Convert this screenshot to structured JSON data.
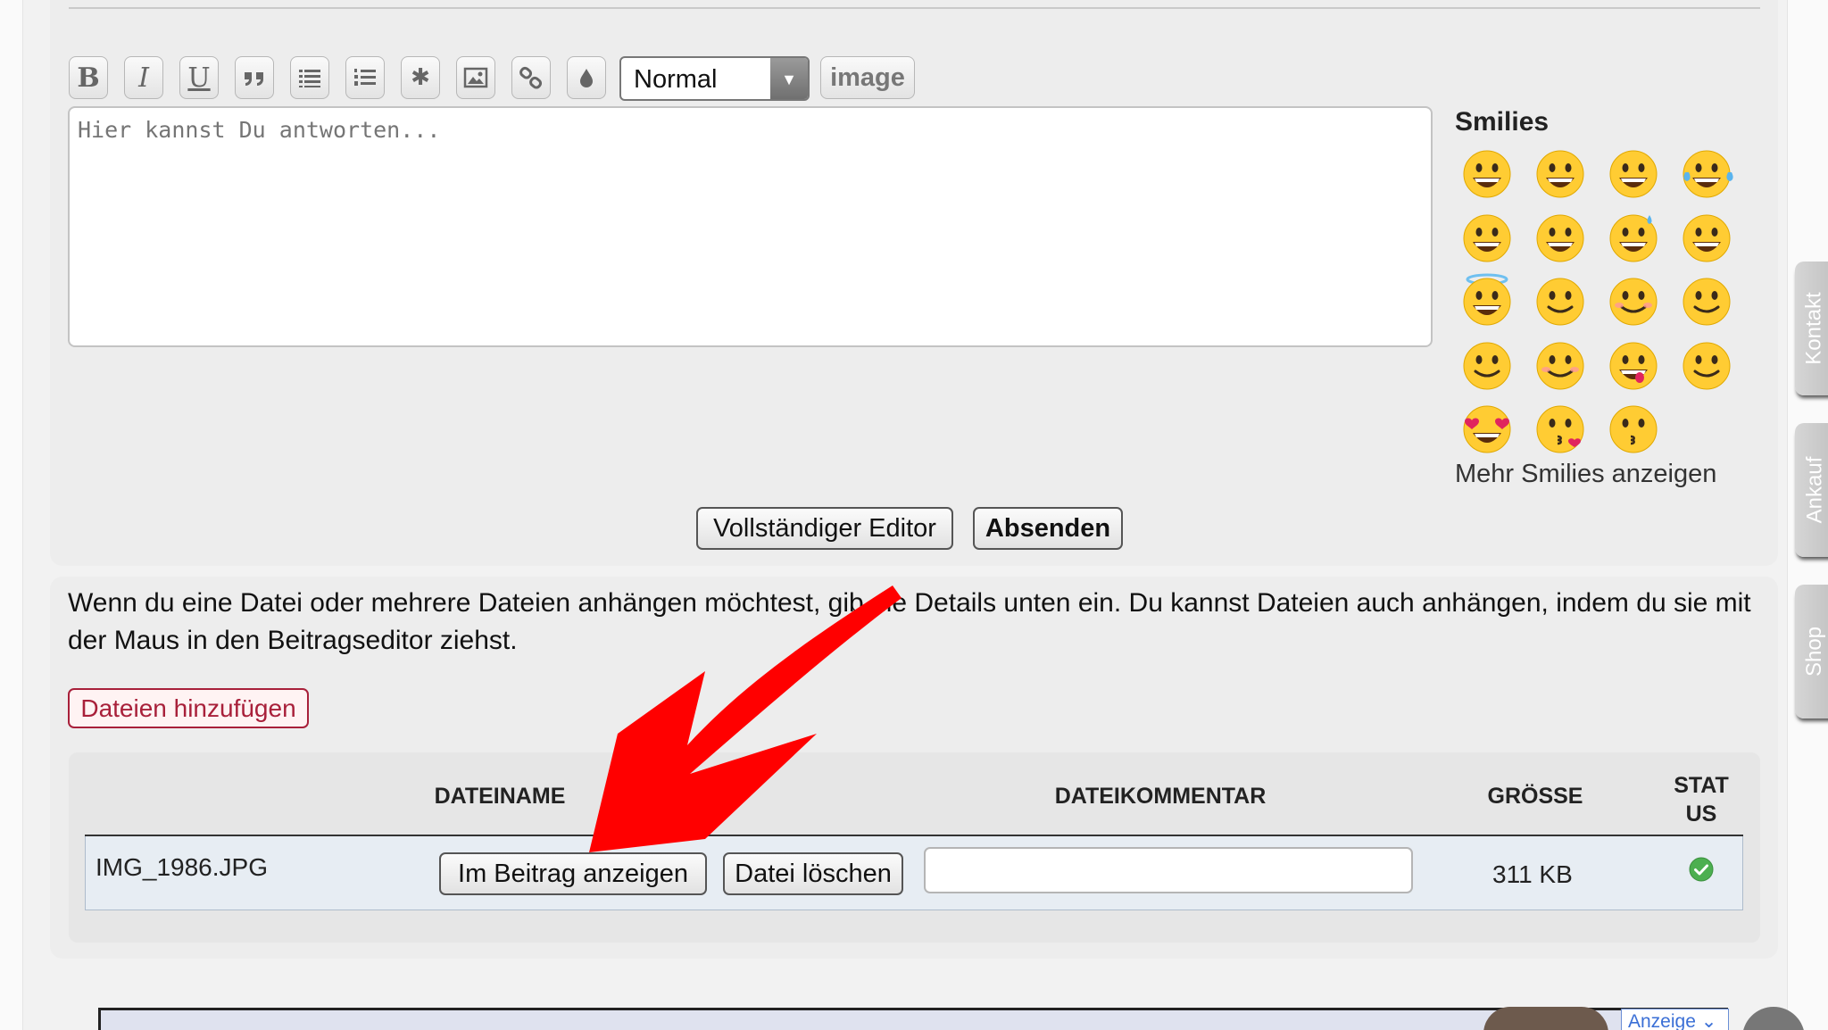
{
  "toolbar": {
    "buttons": [
      {
        "name": "bold-button",
        "icon": "bold-icon",
        "glyph": "B"
      },
      {
        "name": "italic-button",
        "icon": "italic-icon",
        "glyph": "I"
      },
      {
        "name": "underline-button",
        "icon": "underline-icon",
        "glyph": "U"
      },
      {
        "name": "quote-button",
        "icon": "quote-icon",
        "glyph": ""
      },
      {
        "name": "bullet-list-button",
        "icon": "bullet-list-icon",
        "glyph": ""
      },
      {
        "name": "numbered-list-button",
        "icon": "numbered-list-icon",
        "glyph": ""
      },
      {
        "name": "spoiler-button",
        "icon": "asterisk-icon",
        "glyph": "✱"
      },
      {
        "name": "insert-image-button",
        "icon": "picture-icon",
        "glyph": ""
      },
      {
        "name": "insert-link-button",
        "icon": "link-icon",
        "glyph": ""
      },
      {
        "name": "color-button",
        "icon": "droplet-icon",
        "glyph": ""
      }
    ],
    "format_select": {
      "value": "Normal"
    },
    "image_label": "image"
  },
  "editor": {
    "placeholder": "Hier kannst Du antworten..."
  },
  "smilies": {
    "title": "Smilies",
    "icons": [
      "grinning-face-icon",
      "grimacing-face-icon",
      "beaming-face-icon",
      "tears-of-joy-face-icon",
      "smiley-face-icon",
      "grinning-squint-face-icon",
      "sweat-smile-face-icon",
      "laughing-face-icon",
      "angel-face-icon",
      "winking-face-icon",
      "blushing-face-icon",
      "slightly-smiling-face-icon",
      "upside-down-face-icon",
      "relieved-blush-face-icon",
      "yum-face-icon",
      "relieved-face-icon",
      "heart-eyes-face-icon",
      "kissing-heart-face-icon",
      "kissing-face-icon"
    ],
    "more_label": "Mehr Smilies anzeigen"
  },
  "actions": {
    "full_editor_label": "Vollständiger Editor",
    "submit_label": "Absenden"
  },
  "attachments": {
    "info_text": "Wenn du eine Datei oder mehrere Dateien anhängen möchtest, gib die Details unten ein. Du kannst Dateien auch anhängen, indem du sie mit der Maus in den Beitragseditor ziehst.",
    "add_files_label": "Dateien hinzufügen",
    "columns": {
      "filename": "DATEINAME",
      "comment": "DATEIKOMMENTAR",
      "size": "GRÖSSE",
      "status": "STATUS"
    },
    "files": [
      {
        "name": "IMG_1986.JPG",
        "show_label": "Im Beitrag anzeigen",
        "delete_label": "Datei löschen",
        "comment_value": "",
        "size": "311 KB",
        "status_icon": "check-circle-icon",
        "status_color": "#4caf50"
      }
    ]
  },
  "side_tabs": [
    "Kontakt",
    "Ankauf",
    "Shop"
  ],
  "ad": {
    "label": "Anzeige ⌄"
  },
  "annotation": {
    "arrow_color": "#ff0000",
    "arrow_icon": "red-arrow-icon"
  }
}
